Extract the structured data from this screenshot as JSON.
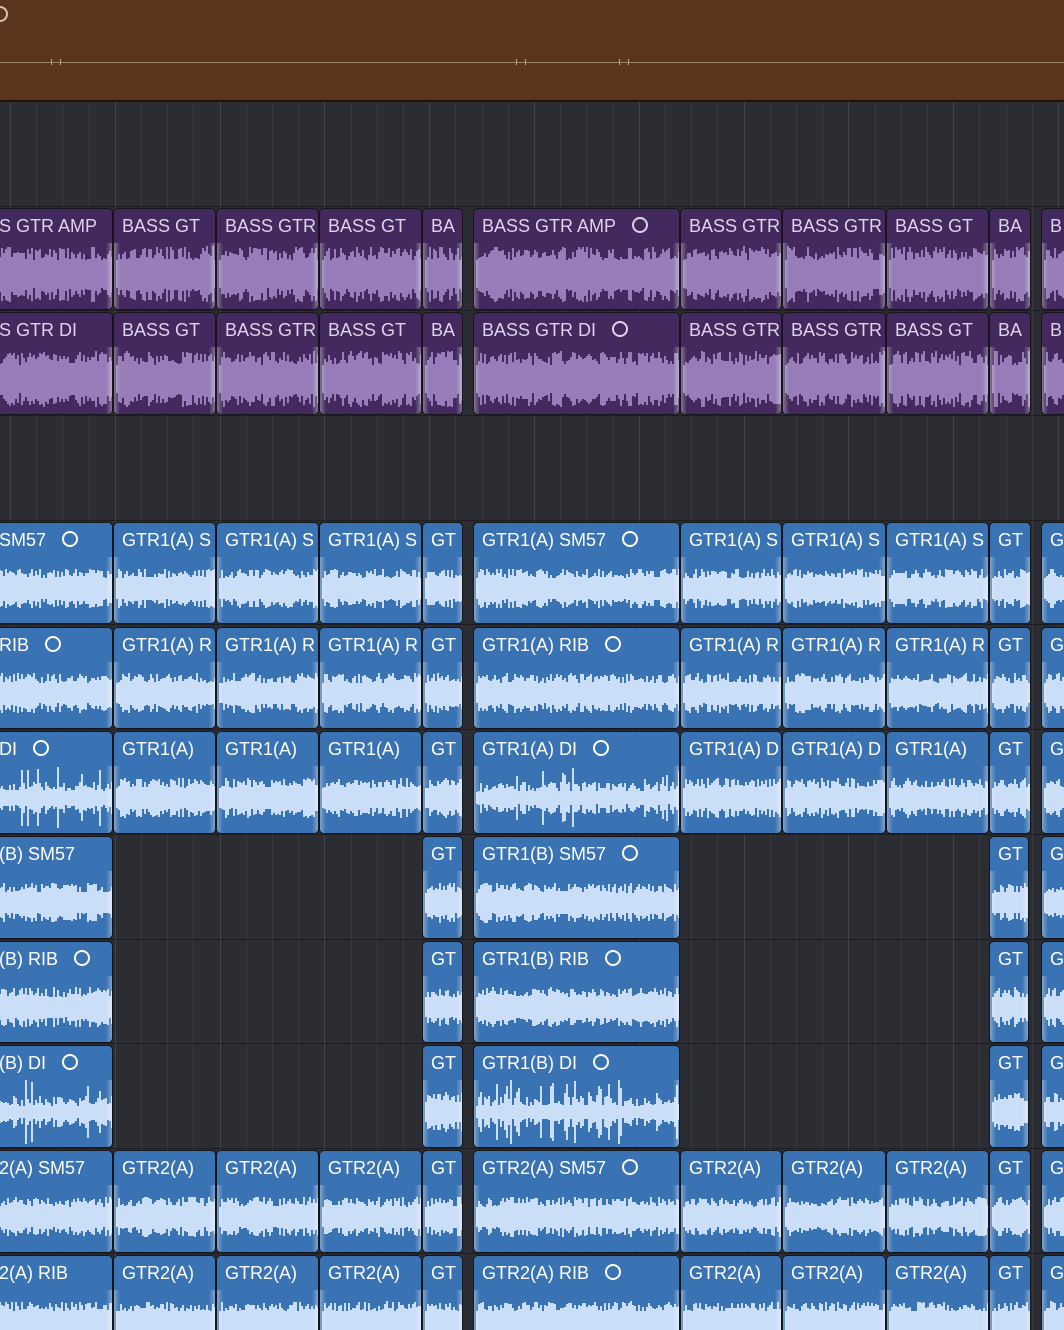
{
  "automation": {
    "color": "#5b361c"
  },
  "colors": {
    "bass": "#43295d",
    "bass_wave": "#a58bc8",
    "gtr": "#3a73b3",
    "gtr_wave": "#d3e4fb",
    "background": "#2b2d33"
  },
  "icons": {
    "loop": "loop-circle-icon"
  },
  "tracks": [
    {
      "kind": "empty"
    },
    {
      "kind": "bass",
      "labels": [
        "S GTR AMP",
        "BASS GT",
        "BASS GTR",
        "BASS GT",
        "BA",
        "BASS GTR AMP",
        "BASS GTR",
        "BASS GTR",
        "BASS GT",
        "BA",
        "B"
      ]
    },
    {
      "kind": "bass",
      "labels": [
        "S GTR DI",
        "BASS GT",
        "BASS GTR",
        "BASS GT",
        "BA",
        "BASS GTR DI",
        "BASS GTR",
        "BASS GTR",
        "BASS GT",
        "BA",
        "B"
      ]
    },
    {
      "kind": "empty"
    },
    {
      "kind": "gtr",
      "labels": [
        "SM57",
        "GTR1(A) S",
        "GTR1(A) S",
        "GTR1(A) S",
        "GT",
        "GTR1(A) SM57",
        "GTR1(A) S",
        "GTR1(A) S",
        "GTR1(A) S",
        "GT",
        "G"
      ]
    },
    {
      "kind": "gtr",
      "labels": [
        "RIB",
        "GTR1(A) R",
        "GTR1(A) R",
        "GTR1(A) R",
        "GT",
        "GTR1(A) RIB",
        "GTR1(A) R",
        "GTR1(A) R",
        "GTR1(A) R",
        "GT",
        "G"
      ]
    },
    {
      "kind": "gtr",
      "labels": [
        "DI",
        "GTR1(A)",
        "GTR1(A)",
        "GTR1(A)",
        "GT",
        "GTR1(A) DI",
        "GTR1(A) D",
        "GTR1(A) D",
        "GTR1(A)",
        "GT",
        "G"
      ]
    },
    {
      "kind": "gtrB",
      "labels": [
        "(B) SM57",
        "GT",
        "GTR1(B) SM57",
        "GT",
        "G"
      ]
    },
    {
      "kind": "gtrB",
      "labels": [
        "(B) RIB",
        "GT",
        "GTR1(B) RIB",
        "GT",
        "G"
      ]
    },
    {
      "kind": "gtrB",
      "labels": [
        "(B) DI",
        "GT",
        "GTR1(B) DI",
        "GT",
        "G"
      ]
    },
    {
      "kind": "gtr",
      "labels": [
        "2(A) SM57",
        "GTR2(A)",
        "GTR2(A)",
        "GTR2(A)",
        "GT",
        "GTR2(A) SM57",
        "GTR2(A)",
        "GTR2(A)",
        "GTR2(A)",
        "GT",
        "G"
      ]
    },
    {
      "kind": "gtr",
      "labels": [
        "2(A) RIB",
        "GTR2(A)",
        "GTR2(A)",
        "GTR2(A)",
        "GT",
        "GTR2(A) RIB",
        "GTR2(A)",
        "GTR2(A)",
        "GTR2(A)",
        "GT",
        "G"
      ]
    }
  ]
}
